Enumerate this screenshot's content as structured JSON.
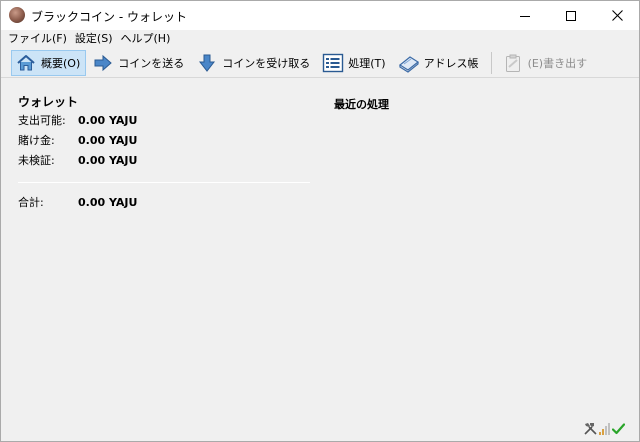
{
  "window": {
    "title": "ブラックコイン - ウォレット"
  },
  "menu": [
    {
      "label": "ファイル(F)"
    },
    {
      "label": "設定(S)"
    },
    {
      "label": "ヘルプ(H)"
    }
  ],
  "toolbar": {
    "overview": "概要(O)",
    "send": "コインを送る",
    "receive": "コインを受け取る",
    "transactions": "処理(T)",
    "addressbook": "アドレス帳",
    "export": "(E)書き出す"
  },
  "wallet": {
    "title": "ウォレット",
    "balance_label": "支出可能:",
    "balance_value": "0.00 YAJU",
    "stake_label": "賭け金:",
    "stake_value": "0.00 YAJU",
    "unconfirmed_label": "未検証:",
    "unconfirmed_value": "0.00 YAJU",
    "total_label": "合計:",
    "total_value": "0.00 YAJU"
  },
  "recent": {
    "title": "最近の処理"
  },
  "colors": {
    "active_button_bg": "#cce4f7",
    "active_button_border": "#99c9ef",
    "synced_check": "#2aa52a"
  }
}
